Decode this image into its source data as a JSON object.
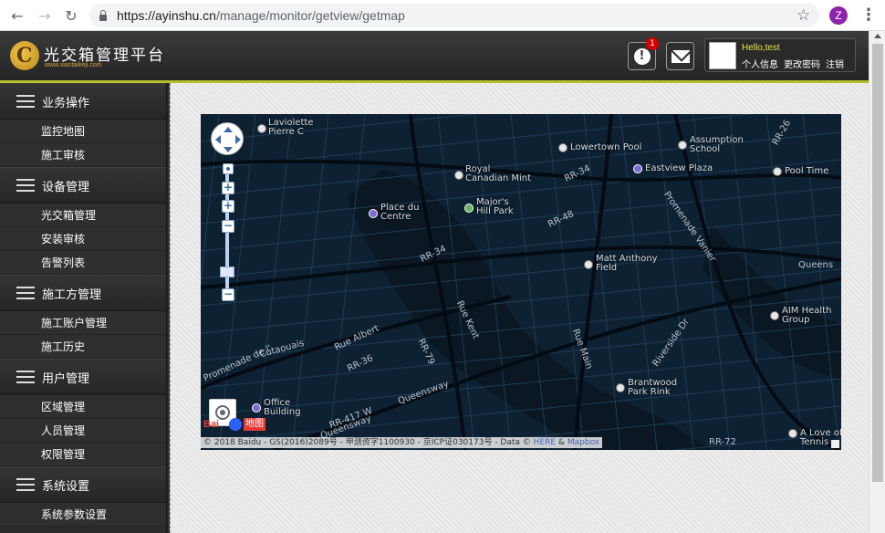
{
  "browser": {
    "url_host": "https://ayinshu.cn",
    "url_path": "/manage/monitor/getview/getmap",
    "profile_initial": "Z"
  },
  "header": {
    "title": "光交箱管理平台",
    "subtitle": "www.xiantaikeji.com",
    "alert_count": "1",
    "greeting": "Hello,test",
    "links": [
      "个人信息",
      "更改密码",
      "注销"
    ]
  },
  "sidebar": {
    "groups": [
      {
        "label": "业务操作",
        "items": [
          "监控地图",
          "施工审核"
        ]
      },
      {
        "label": "设备管理",
        "items": [
          "光交箱管理",
          "安装审核",
          "告警列表"
        ]
      },
      {
        "label": "施工方管理",
        "items": [
          "施工账户管理",
          "施工历史"
        ]
      },
      {
        "label": "用户管理",
        "items": [
          "区域管理",
          "人员管理",
          "权限管理"
        ]
      },
      {
        "label": "系统设置",
        "items": [
          "系统参数设置"
        ]
      }
    ]
  },
  "map": {
    "places": [
      {
        "name": "Laviolette\nPierre C",
        "poi": "gray"
      },
      {
        "name": "Royal\nCanadian Mint",
        "poi": "gray"
      },
      {
        "name": "Lowertown Pool",
        "poi": "gray"
      },
      {
        "name": "Assumption\nSchool",
        "poi": "gray"
      },
      {
        "name": "Eastview Plaza",
        "poi": "purple"
      },
      {
        "name": "Pool Time",
        "poi": "gray"
      },
      {
        "name": "Place du\nCentre",
        "poi": "purple"
      },
      {
        "name": "Major's\nHill Park",
        "poi": "green"
      },
      {
        "name": "Matt Anthony\nField",
        "poi": "gray"
      },
      {
        "name": "AIM Health\nGroup",
        "poi": "gray"
      },
      {
        "name": "Brantwood\nPark Rink",
        "poi": "gray"
      },
      {
        "name": "Office\nBuilding",
        "poi": "purple"
      },
      {
        "name": "A Love of\nTennis",
        "poi": "gray"
      }
    ],
    "roads": [
      "RR-34",
      "RR-48",
      "RR-34",
      "Rue Albert",
      "RR-36",
      "RR-79",
      "Rue Kent",
      "Rue Main",
      "Queensway",
      "Queens",
      "Promenade Vanier",
      "Riverside Dr",
      "Cutaouais",
      "RR-72",
      "RR-26",
      "Queensway",
      "RR-417 W",
      "Promenade de l'"
    ],
    "attribution_main": "© 2018 Baidu - GS(2016)2089号 - 甲测资字1100930 - 京ICP证030173号 - Data ©",
    "attribution_here": "HERE",
    "attribution_amp": "&",
    "attribution_mapbox": "Mapbox",
    "baidu_text": "Bai",
    "baidu_map_text": "地图"
  }
}
